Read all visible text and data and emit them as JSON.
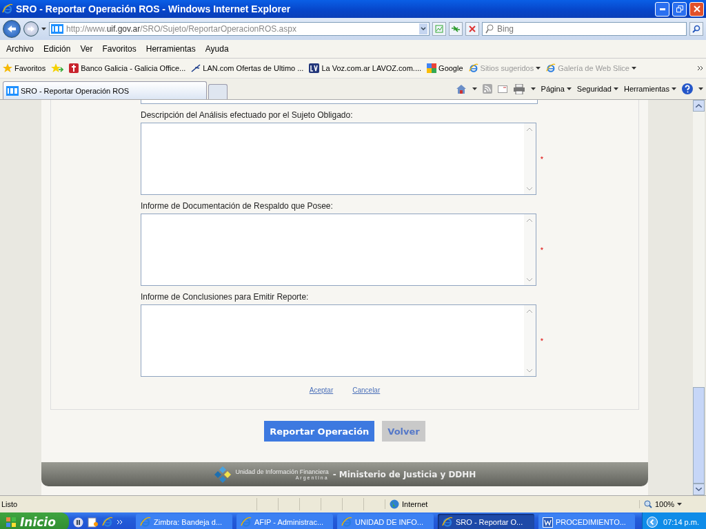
{
  "window": {
    "title": "SRO - Reportar Operación ROS - Windows Internet Explorer"
  },
  "address_bar": {
    "url_prefix": "http://www.",
    "url_domain": "uif.gov.ar",
    "url_path": "/SRO/Sujeto/ReportarOperacionROS.aspx"
  },
  "search": {
    "placeholder": "Bing"
  },
  "menu": [
    "Archivo",
    "Edición",
    "Ver",
    "Favoritos",
    "Herramientas",
    "Ayuda"
  ],
  "favorites_bar": {
    "label": "Favoritos",
    "links": [
      {
        "label": "Banco Galicia - Galicia Office...",
        "kind": "galicia",
        "disabled": false,
        "dropdown": false
      },
      {
        "label": "LAN.com Ofertas de Ultimo ...",
        "kind": "lan",
        "disabled": false,
        "dropdown": false
      },
      {
        "label": "La Voz.com.ar  LAVOZ.com....",
        "kind": "lavoz",
        "disabled": false,
        "dropdown": false
      },
      {
        "label": "Google",
        "kind": "google",
        "disabled": false,
        "dropdown": false
      },
      {
        "label": "Sitios sugeridos",
        "kind": "ie",
        "disabled": true,
        "dropdown": true
      },
      {
        "label": "Galería de Web Slice",
        "kind": "ie",
        "disabled": true,
        "dropdown": true
      }
    ]
  },
  "tabs": [
    {
      "label": "SRO - Reportar Operación ROS",
      "selected": true
    }
  ],
  "command_bar": [
    "Página",
    "Seguridad",
    "Herramientas"
  ],
  "form": {
    "fields": [
      {
        "label": "Descripción del Análisis efectuado por el Sujeto Obligado:",
        "required": true
      },
      {
        "label": "Informe de Documentación de Respaldo que Posee:",
        "required": true
      },
      {
        "label": "Informe de Conclusiones para Emitir Reporte:",
        "required": true
      }
    ],
    "required_mark": "*",
    "links": [
      "Aceptar",
      "Cancelar"
    ],
    "buttons": [
      {
        "label": "Reportar Operación",
        "kind": "primary"
      },
      {
        "label": "Volver",
        "kind": "secondary"
      }
    ]
  },
  "footer": {
    "org_name": "Unidad de Información Financiera",
    "org_country": "Argentina",
    "ministry": "- Ministerio de Justicia y DDHH"
  },
  "status_bar": {
    "status": "Listo",
    "zone": "Internet",
    "zoom": "100%"
  },
  "taskbar": {
    "start": "Inicio",
    "items": [
      {
        "label": "Zimbra: Bandeja d...",
        "kind": "ie",
        "selected": false
      },
      {
        "label": "AFIP - Administrac...",
        "kind": "ie",
        "selected": false
      },
      {
        "label": "UNIDAD DE INFO...",
        "kind": "ie",
        "selected": false
      },
      {
        "label": "SRO - Reportar O...",
        "kind": "ie",
        "selected": true
      },
      {
        "label": "PROCEDIMIENTO...",
        "kind": "word",
        "selected": false
      }
    ],
    "clock": "07:14 p.m."
  }
}
